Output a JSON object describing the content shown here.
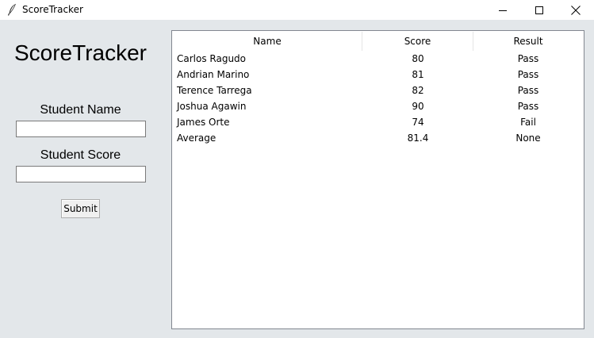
{
  "window": {
    "title": "ScoreTracker",
    "icon": "feather-icon",
    "controls": [
      "minimize-icon",
      "maximize-icon",
      "close-icon"
    ]
  },
  "form": {
    "heading": "ScoreTracker",
    "name_label": "Student Name",
    "name_value": "",
    "score_label": "Student Score",
    "score_value": "",
    "submit_label": "Submit"
  },
  "table": {
    "columns": [
      "Name",
      "Score",
      "Result"
    ],
    "rows": [
      [
        "Carlos Ragudo",
        "80",
        "Pass"
      ],
      [
        "Andrian Marino",
        "81",
        "Pass"
      ],
      [
        "Terence Tarrega",
        "82",
        "Pass"
      ],
      [
        "Joshua Agawin",
        "90",
        "Pass"
      ],
      [
        "James Orte",
        "74",
        "Fail"
      ],
      [
        "Average",
        "81.4",
        "None"
      ]
    ]
  }
}
